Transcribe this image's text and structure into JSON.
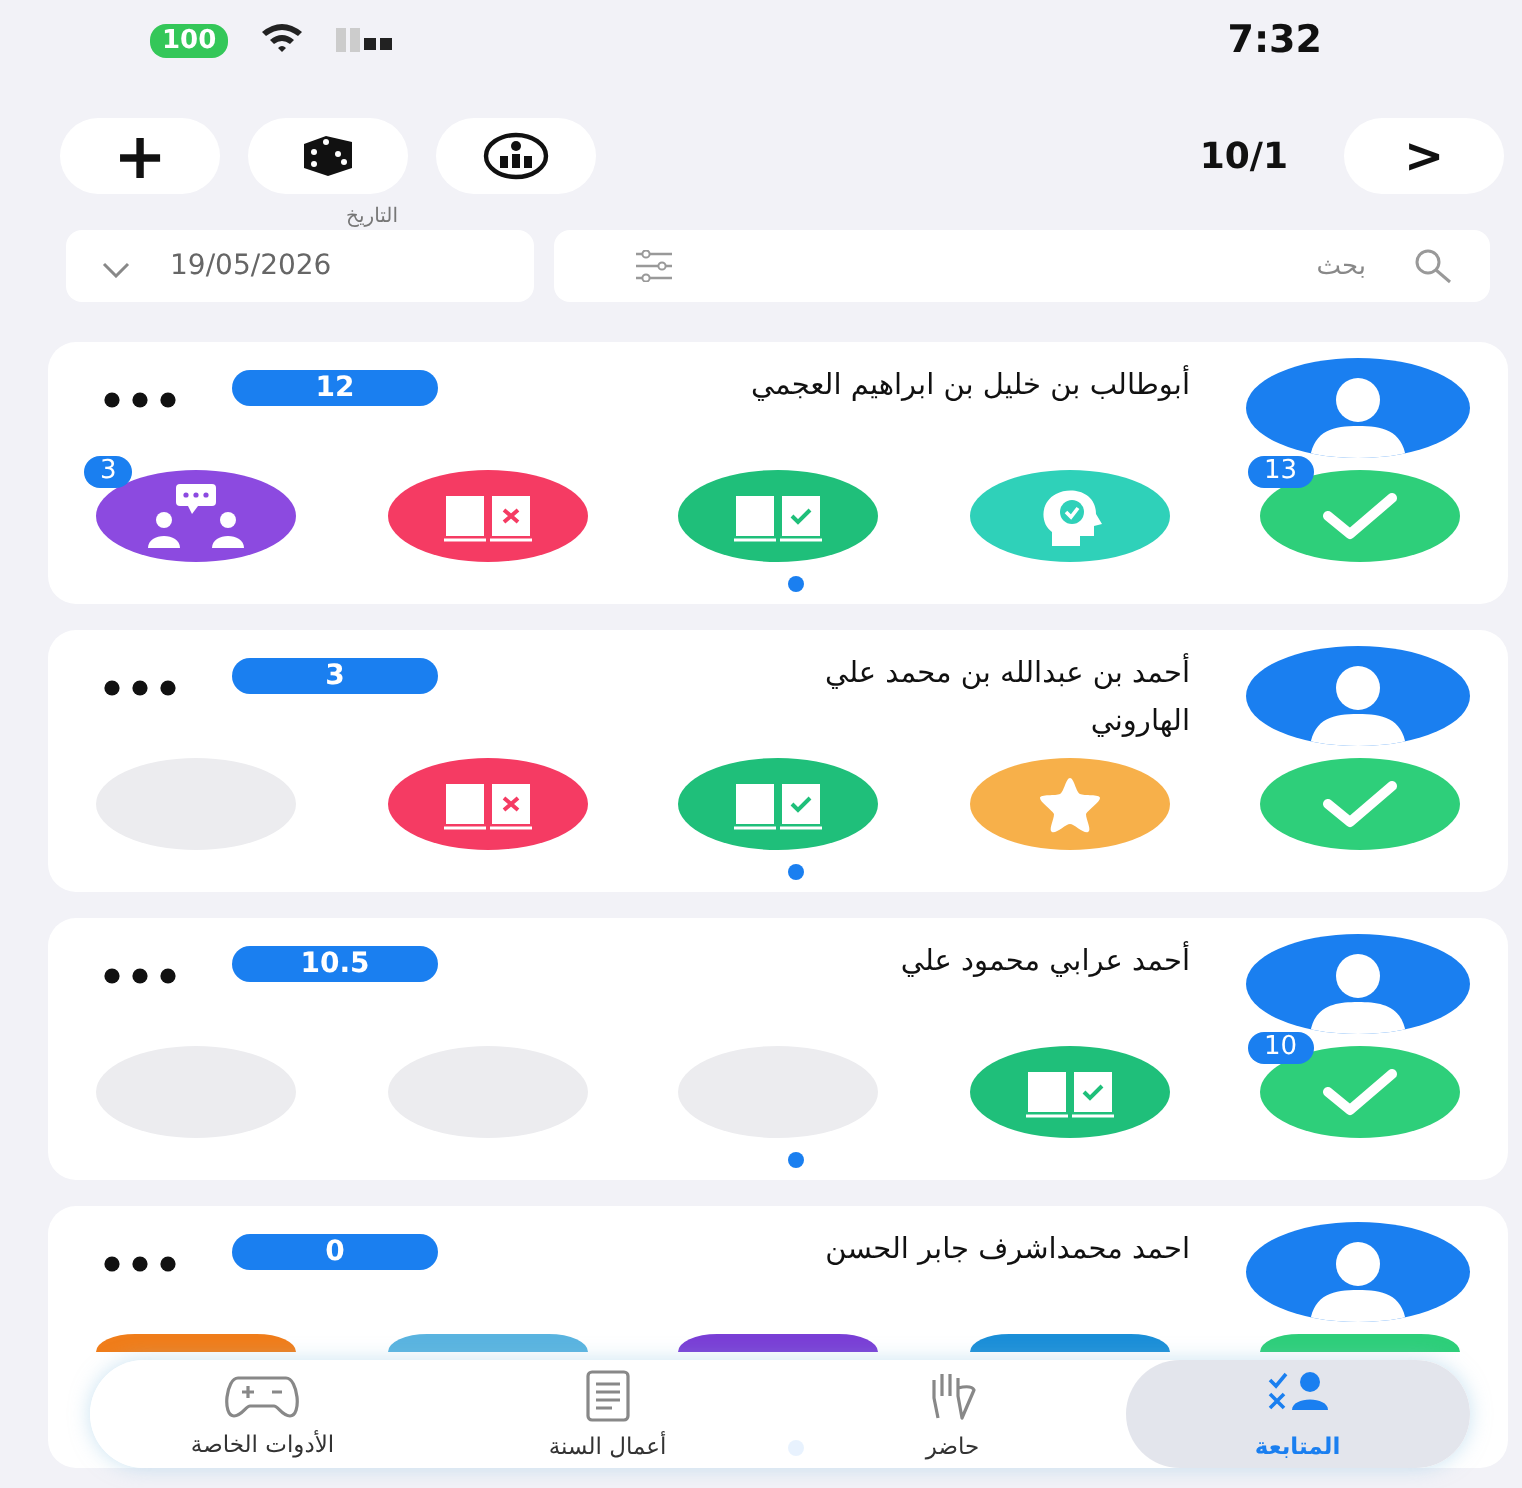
{
  "status_bar": {
    "battery": "100",
    "time": "7:32"
  },
  "toolbar": {
    "add_label": "+",
    "page": "10/1",
    "next_label": ">"
  },
  "date_field": {
    "label": "التاريخ",
    "value": "19/05/2026"
  },
  "search": {
    "placeholder": "بحث"
  },
  "students": [
    {
      "name": "أبوطالب بن خليل بن ابراهيم العجمي",
      "score": "12",
      "actions": [
        {
          "kind": "check",
          "badge": "13"
        },
        {
          "kind": "head"
        },
        {
          "kind": "book_check"
        },
        {
          "kind": "book_x"
        },
        {
          "kind": "people",
          "badge": "3"
        }
      ]
    },
    {
      "name": "أحمد بن عبدالله بن محمد علي\nالهاروني",
      "score": "3",
      "actions": [
        {
          "kind": "check"
        },
        {
          "kind": "star"
        },
        {
          "kind": "book_check"
        },
        {
          "kind": "book_x"
        },
        {
          "kind": "empty"
        }
      ]
    },
    {
      "name": "أحمد عرابي  محمود علي",
      "score": "10.5",
      "actions": [
        {
          "kind": "check",
          "badge": "10"
        },
        {
          "kind": "book_check"
        },
        {
          "kind": "empty"
        },
        {
          "kind": "empty"
        },
        {
          "kind": "empty"
        }
      ]
    },
    {
      "name": "احمد محمداشرف جابر الحسن",
      "score": "0",
      "actions": [
        {
          "kind": "covered",
          "color": "#2ecf7a"
        },
        {
          "kind": "covered",
          "color": "#1b8fd8"
        },
        {
          "kind": "covered",
          "color": "#7a3fd6"
        },
        {
          "kind": "covered",
          "color": "#5ab4e0"
        },
        {
          "kind": "covered",
          "color": "#f07d1a"
        }
      ]
    }
  ],
  "tab_bar": {
    "tabs": [
      {
        "kind": "follow",
        "label": "المتابعة",
        "selected": true
      },
      {
        "kind": "present",
        "label": "حاضر",
        "selected": false
      },
      {
        "kind": "works",
        "label": "أعمال السنة",
        "selected": false
      },
      {
        "kind": "tools",
        "label": "الأدوات الخاصة",
        "selected": false
      }
    ]
  }
}
